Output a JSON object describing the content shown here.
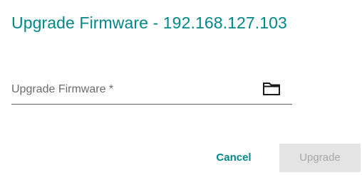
{
  "dialog": {
    "title": "Upgrade Firmware - 192.168.127.103",
    "field": {
      "label": "Upgrade Firmware *",
      "icon": "folder-icon"
    },
    "actions": {
      "cancel_label": "Cancel",
      "upgrade_label": "Upgrade",
      "upgrade_disabled": true
    }
  },
  "colors": {
    "accent": "#008787",
    "disabled_bg": "#e4e4e4",
    "disabled_text": "#a8a8a8"
  }
}
